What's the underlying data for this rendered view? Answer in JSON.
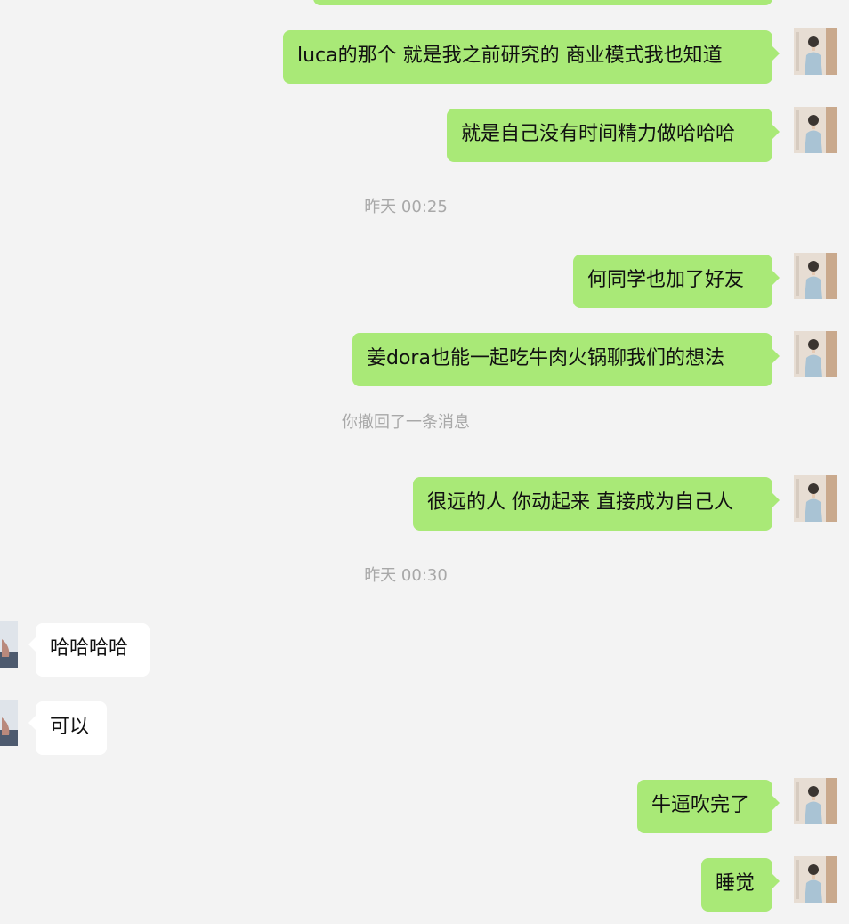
{
  "colors": {
    "background": "#f3f3f3",
    "outgoing_bubble": "#a9e977",
    "incoming_bubble": "#ffffff",
    "timestamp_text": "#a8a8a8"
  },
  "messages": [
    {
      "sender": "self",
      "text": "luca的那个 就是我之前研究的 商业模式我也知道"
    },
    {
      "sender": "self",
      "text": "就是自己没有时间精力做哈哈哈"
    },
    {
      "type": "timestamp",
      "text": "昨天 00:25"
    },
    {
      "sender": "self",
      "text": "何同学也加了好友"
    },
    {
      "sender": "self",
      "text": "姜dora也能一起吃牛肉火锅聊我们的想法"
    },
    {
      "type": "system",
      "text": "你撤回了一条消息"
    },
    {
      "sender": "self",
      "text": "很远的人 你动起来 直接成为自己人"
    },
    {
      "type": "timestamp",
      "text": "昨天 00:30"
    },
    {
      "sender": "peer",
      "text": "哈哈哈哈"
    },
    {
      "sender": "peer",
      "text": "可以"
    },
    {
      "sender": "self",
      "text": "牛逼吹完了"
    },
    {
      "sender": "self",
      "text": "睡觉"
    }
  ]
}
